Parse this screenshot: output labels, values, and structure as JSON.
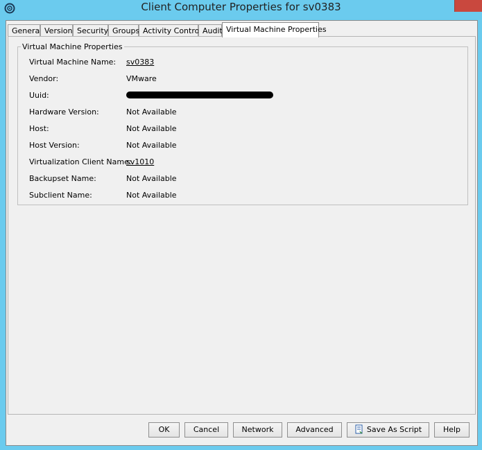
{
  "window": {
    "title": "Client Computer Properties for sv0383"
  },
  "tabs": [
    {
      "label": "General"
    },
    {
      "label": "Version"
    },
    {
      "label": "Security"
    },
    {
      "label": "Groups"
    },
    {
      "label": "Activity Control"
    },
    {
      "label": "Audit"
    },
    {
      "label": "Virtual Machine Properties",
      "active": true
    }
  ],
  "group": {
    "title": "Virtual Machine Properties",
    "rows": [
      {
        "label": "Virtual Machine Name:",
        "value": "sv0383",
        "link": true
      },
      {
        "label": "Vendor:",
        "value": "VMware"
      },
      {
        "label": "Uuid:",
        "value": "[redacted]",
        "redacted": true
      },
      {
        "label": "Hardware Version:",
        "value": "Not Available"
      },
      {
        "label": "Host:",
        "value": "Not Available"
      },
      {
        "label": "Host Version:",
        "value": "Not Available"
      },
      {
        "label": "Virtualization Client Name:",
        "value": "sv1010",
        "link": true
      },
      {
        "label": "Backupset Name:",
        "value": "Not Available"
      },
      {
        "label": "Subclient Name:",
        "value": "Not Available"
      }
    ]
  },
  "buttons": {
    "ok": "OK",
    "cancel": "Cancel",
    "network": "Network",
    "advanced": "Advanced",
    "save_script": "Save As Script",
    "help": "Help"
  },
  "icons": {
    "app": "commvault-logo-icon",
    "save_script": "script-icon"
  },
  "colors": {
    "title_bar": "#6bcbee",
    "close": "#c9483e",
    "panel": "#f0f0f0"
  }
}
